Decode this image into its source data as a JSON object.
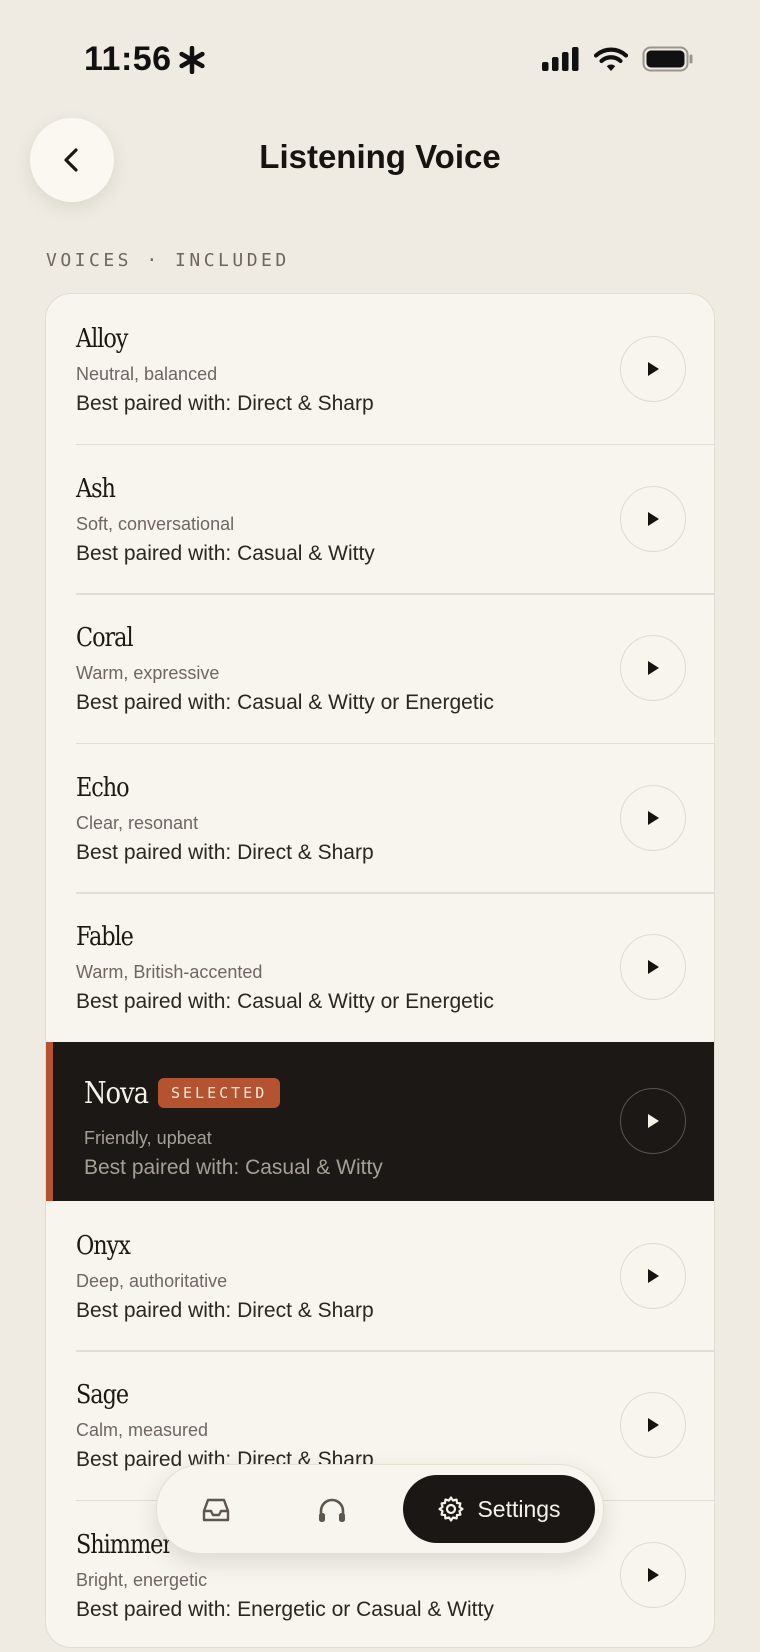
{
  "status_bar": {
    "time": "11:56",
    "icons": [
      "asterisk-icon",
      "signal-icon",
      "wifi-icon",
      "battery-icon"
    ]
  },
  "header": {
    "title": "Listening Voice",
    "back_icon": "chevron-left-icon"
  },
  "section": {
    "label": "VOICES · INCLUDED"
  },
  "voices": [
    {
      "name": "Alloy",
      "description": "Neutral, balanced",
      "pairing": "Best paired with: Direct & Sharp"
    },
    {
      "name": "Ash",
      "description": "Soft, conversational",
      "pairing": "Best paired with: Casual & Witty"
    },
    {
      "name": "Coral",
      "description": "Warm, expressive",
      "pairing": "Best paired with: Casual & Witty or Energetic"
    },
    {
      "name": "Echo",
      "description": "Clear, resonant",
      "pairing": "Best paired with: Direct & Sharp"
    },
    {
      "name": "Fable",
      "description": "Warm, British-accented",
      "pairing": "Best paired with: Casual & Witty or Energetic"
    },
    {
      "name": "Nova",
      "description": "Friendly, upbeat",
      "pairing": "Best paired with: Casual & Witty",
      "badge": "SELECTED"
    },
    {
      "name": "Onyx",
      "description": "Deep, authoritative",
      "pairing": "Best paired with: Direct & Sharp"
    },
    {
      "name": "Sage",
      "description": "Calm, measured",
      "pairing": "Best paired with: Direct & Sharp"
    },
    {
      "name": "Shimmer",
      "description": "Bright, energetic",
      "pairing": "Best paired with: Energetic or Casual & Witty"
    }
  ],
  "tabbar": {
    "inbox_icon": "inbox-icon",
    "listen_icon": "headphones-icon",
    "settings_label": "Settings",
    "settings_icon": "gear-icon"
  },
  "colors": {
    "background": "#efebe2",
    "card": "#f8f5ee",
    "selected_row": "#1c1815",
    "accent": "#b5522f"
  }
}
